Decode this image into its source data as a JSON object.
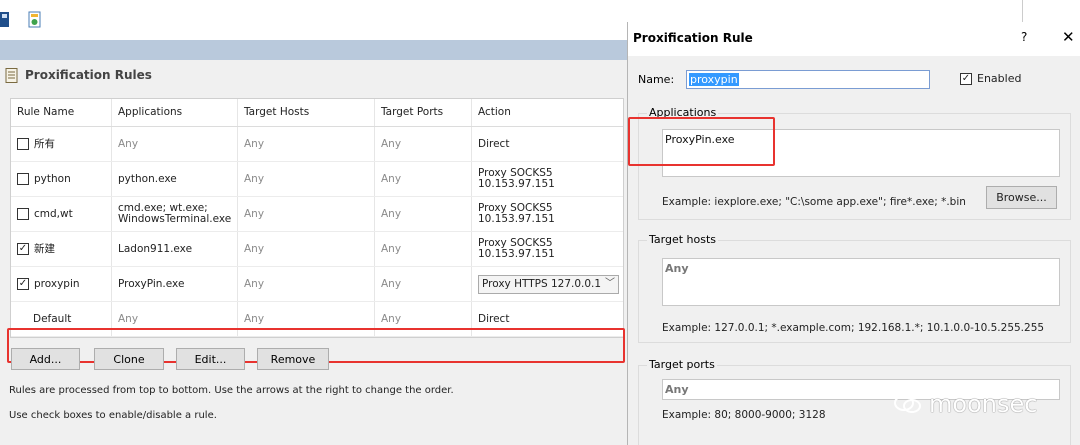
{
  "toolbar": {
    "icons": [
      "save-icon",
      "profile-icon"
    ]
  },
  "rules_panel": {
    "title": "Proxification Rules",
    "columns": [
      "Rule Name",
      "Applications",
      "Target Hosts",
      "Target Ports",
      "Action"
    ],
    "rows": [
      {
        "checked": false,
        "name": "所有",
        "apps": "Any",
        "hosts": "Any",
        "ports": "Any",
        "action": "Direct"
      },
      {
        "checked": false,
        "name": "python",
        "apps": "python.exe",
        "hosts": "Any",
        "ports": "Any",
        "action": "Proxy SOCKS5\n10.153.97.151"
      },
      {
        "checked": false,
        "name": "cmd,wt",
        "apps": "cmd.exe; wt.exe;\nWindowsTerminal.exe",
        "hosts": "Any",
        "ports": "Any",
        "action": "Proxy SOCKS5\n10.153.97.151"
      },
      {
        "checked": true,
        "name": "新建",
        "apps": "Ladon911.exe",
        "hosts": "Any",
        "ports": "Any",
        "action": "Proxy SOCKS5\n10.153.97.151"
      },
      {
        "checked": true,
        "name": "proxypin",
        "apps": "ProxyPin.exe",
        "hosts": "Any",
        "ports": "Any",
        "action": "Proxy HTTPS 127.0.0.1"
      },
      {
        "checked": null,
        "name": "Default",
        "apps": "Any",
        "hosts": "Any",
        "ports": "Any",
        "action": "Direct"
      }
    ],
    "buttons": {
      "add": "Add...",
      "clone": "Clone",
      "edit": "Edit...",
      "remove": "Remove"
    },
    "hint1": "Rules are processed from top to bottom. Use the arrows at the right to change the order.",
    "hint2": "Use check boxes to enable/disable a rule."
  },
  "dialog": {
    "title": "Proxification Rule",
    "help": "?",
    "close": "✕",
    "name_label": "Name:",
    "name_value": "proxypin",
    "enabled_label": "Enabled",
    "enabled": true,
    "applications": {
      "title": "Applications",
      "value": "ProxyPin.exe",
      "example": "Example: iexplore.exe; \"C:\\some app.exe\"; fire*.exe; *.bin",
      "browse": "Browse..."
    },
    "target_hosts": {
      "title": "Target hosts",
      "value": "Any",
      "example": "Example: 127.0.0.1; *.example.com; 192.168.1.*; 10.1.0.0-10.5.255.255"
    },
    "target_ports": {
      "title": "Target ports",
      "value": "Any",
      "example": "Example: 80; 8000-9000; 3128"
    }
  },
  "watermark": {
    "text": "moonsec"
  },
  "colors": {
    "highlight": "#e8332f",
    "selection": "#3399ff",
    "strip": "#b9c9dc"
  }
}
